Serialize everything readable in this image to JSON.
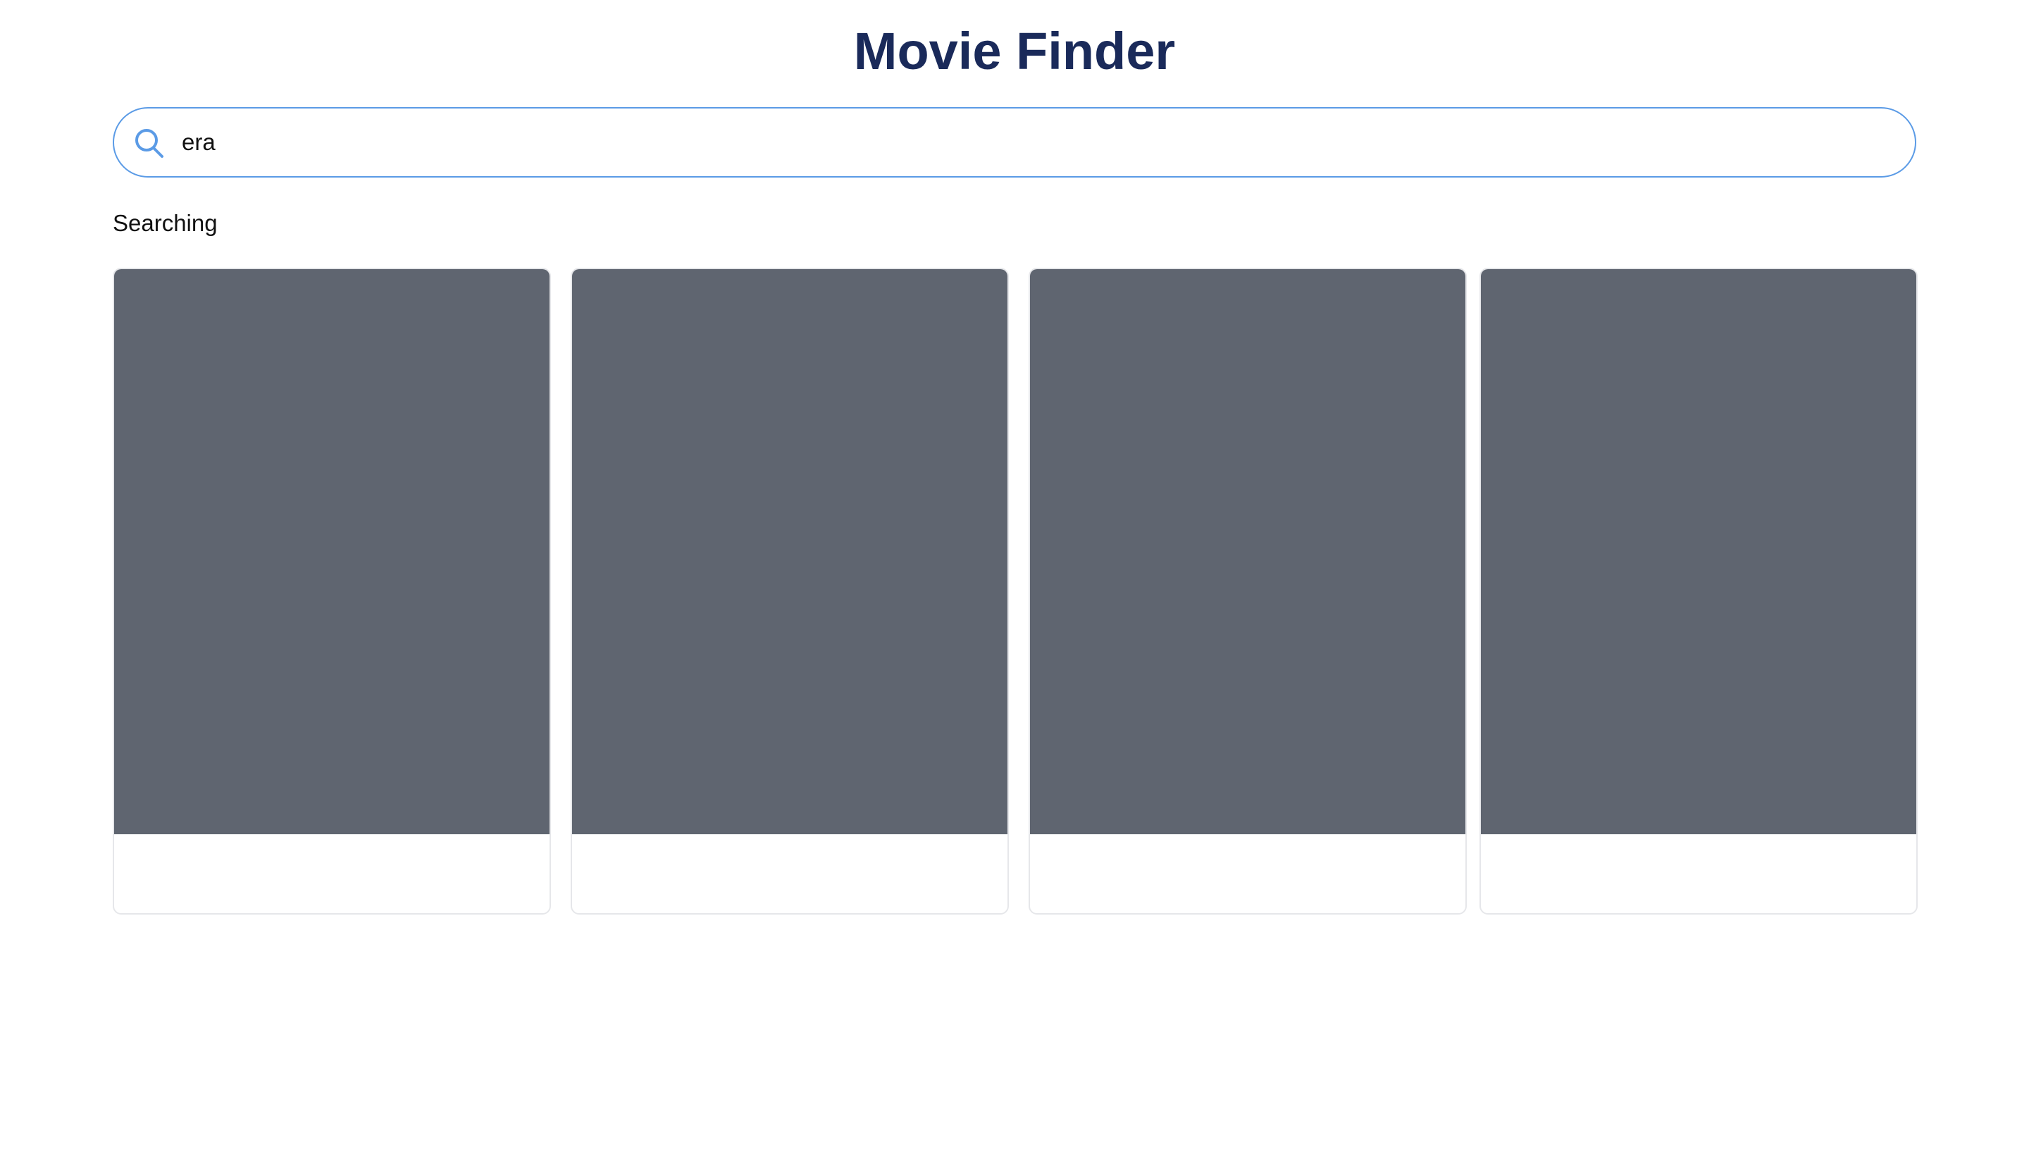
{
  "header": {
    "title": "Movie Finder"
  },
  "search": {
    "icon": "search-icon",
    "value": "era",
    "placeholder": "",
    "accent_color": "#5b9be6"
  },
  "status": {
    "text": "Searching"
  },
  "results": {
    "cards": [
      {
        "title": "",
        "poster_color": "#5f6570"
      },
      {
        "title": "",
        "poster_color": "#5f6570"
      },
      {
        "title": "",
        "poster_color": "#5f6570"
      },
      {
        "title": "",
        "poster_color": "#5f6570"
      }
    ]
  }
}
